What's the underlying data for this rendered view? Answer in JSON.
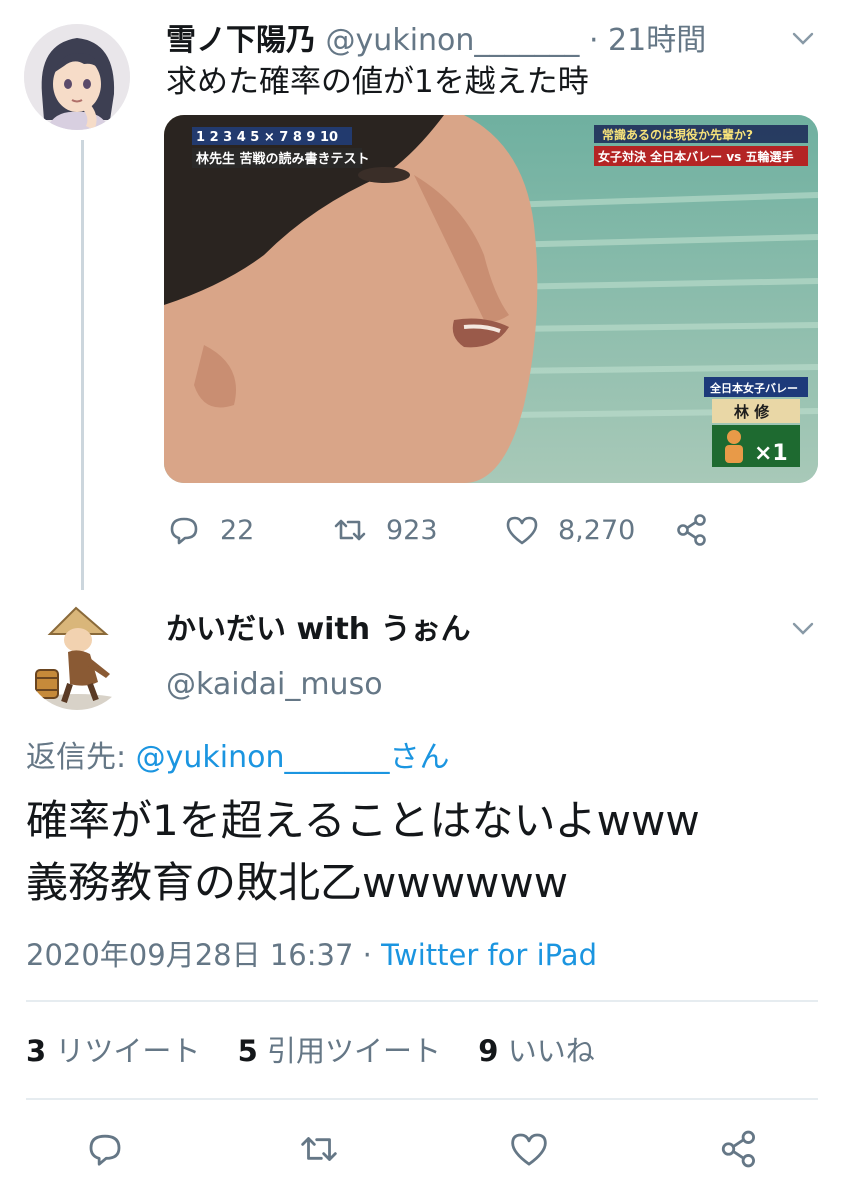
{
  "parent_tweet": {
    "display_name": "雪ノ下陽乃",
    "handle": "@yukinon_______",
    "separator": "·",
    "time": "21時間",
    "text": "求めた確率の値が1を越えた時",
    "media": {
      "overlay_top_left_line1": "1 2 3 4 5 × 7 8 9 10",
      "overlay_top_left_line2": "林先生 苦戦の読み書きテスト",
      "overlay_top_right_line1": "常識あるのは現役か先輩か?",
      "overlay_top_right_line2": "女子対決 全日本バレー vs 五輪選手",
      "overlay_badge_team": "全日本女子バレー",
      "overlay_badge_name": "林 修",
      "overlay_badge_count": "×1"
    },
    "actions": {
      "reply_count": "22",
      "retweet_count": "923",
      "like_count": "8,270"
    }
  },
  "reply_tweet": {
    "display_name": "かいだい with うぉん",
    "handle": "@kaidai_muso",
    "replying_label": "返信先:",
    "replying_mention": "@yukinon_______",
    "replying_suffix": "さん",
    "text_line1": "確率が1を超えることはないよwww",
    "text_line2": "義務教育の敗北乙wwwwww",
    "timestamp": "2020年09月28日 16:37",
    "separator": "·",
    "source": "Twitter for iPad",
    "stats": {
      "retweets_count": "3",
      "retweets_label": "リツイート",
      "quotes_count": "5",
      "quotes_label": "引用ツイート",
      "likes_count": "9",
      "likes_label": "いいね"
    }
  },
  "icons": {
    "reply": "reply-icon",
    "retweet": "retweet-icon",
    "like": "heart-icon",
    "share": "share-icon",
    "more": "chevron-down-icon"
  },
  "colors": {
    "link": "#1b95e0",
    "secondary_text": "#657786",
    "primary_text": "#14171a",
    "divider": "#e6ecf0"
  }
}
